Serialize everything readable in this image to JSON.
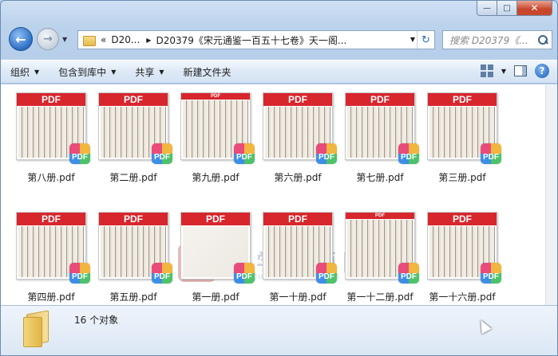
{
  "window": {
    "caption": {
      "minimize": "—",
      "maximize": "□",
      "close": "✕"
    }
  },
  "nav": {
    "back_icon": "←",
    "forward_icon": "→",
    "history_icon": "▼",
    "address": {
      "prefix": "«",
      "segment1": "D20...",
      "segment2": "D20379《宋元通鉴一百五十七卷》天一阁...",
      "dropdown": "▼",
      "refresh": "↻"
    },
    "search_placeholder": "搜索 D20379《..."
  },
  "toolbar": {
    "organize": "组织",
    "include_in_library": "包含到库中",
    "share": "共享",
    "new_folder": "新建文件夹",
    "dropdown_glyph": "▼",
    "help": "?"
  },
  "files": [
    {
      "name": "第八册.pdf",
      "band": "PDF",
      "badge": "PDF"
    },
    {
      "name": "第二册.pdf",
      "band": "PDF",
      "badge": "PDF"
    },
    {
      "name": "第九册.pdf",
      "band": "PDF",
      "badge": "PDF"
    },
    {
      "name": "第六册.pdf",
      "band": "PDF",
      "badge": "PDF"
    },
    {
      "name": "第七册.pdf",
      "band": "PDF",
      "badge": "PDF"
    },
    {
      "name": "第三册.pdf",
      "band": "PDF",
      "badge": "PDF"
    },
    {
      "name": "第四册.pdf",
      "band": "PDF",
      "badge": "PDF"
    },
    {
      "name": "第五册.pdf",
      "band": "PDF",
      "badge": "PDF"
    },
    {
      "name": "第一册.pdf",
      "band": "PDF",
      "badge": "PDF"
    },
    {
      "name": "第一十册.pdf",
      "band": "PDF",
      "badge": "PDF"
    },
    {
      "name": "第一十二册.pdf",
      "band": "PDF",
      "badge": "PDF"
    },
    {
      "name": "第一十六册.pdf",
      "band": "PDF",
      "badge": "PDF"
    }
  ],
  "watermark": {
    "logo_char": "國",
    "title": "国学资源网",
    "url": "www.guoxueziyuan.com"
  },
  "status": {
    "count": "16 个对象"
  }
}
